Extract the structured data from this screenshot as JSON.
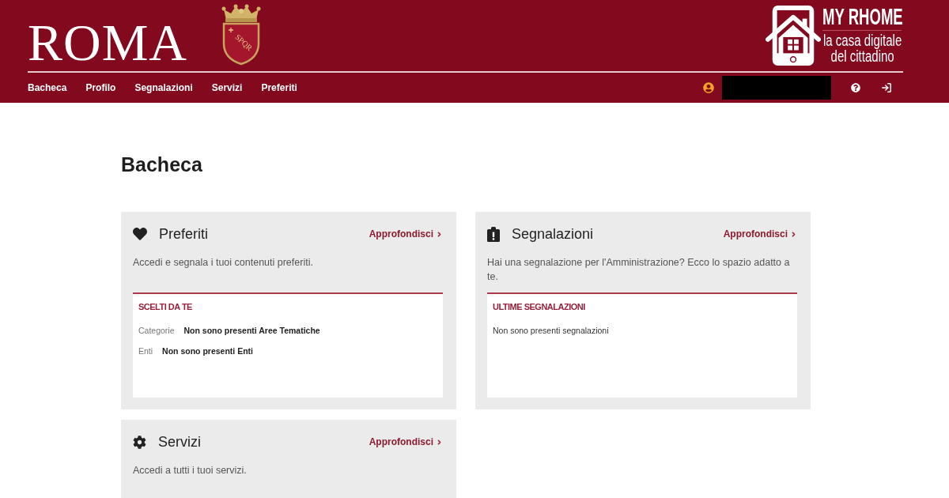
{
  "header": {
    "city_name": "ROMA",
    "crest_motto": "SPQR",
    "app_name": "MY RHOME",
    "app_tagline": "la casa digitale del cittadino",
    "nav": [
      "Bacheca",
      "Profilo",
      "Segnalazioni",
      "Servizi",
      "Preferiti"
    ]
  },
  "page_title": "Bacheca",
  "cards": [
    {
      "kind": "favorites",
      "title": "Preferiti",
      "link": "Approfondisci",
      "description": "Accedi e segnala i tuoi contenuti preferiti.",
      "panel": {
        "heading": "SCELTI DA TE",
        "rows": [
          {
            "label": "Categorie",
            "value": "Non sono presenti Aree Tematiche"
          },
          {
            "label": "Enti",
            "value": "Non sono presenti Enti"
          }
        ]
      }
    },
    {
      "kind": "reports",
      "title": "Segnalazioni",
      "link": "Approfondisci",
      "description": "Hai una segnalazione per l'Amministrazione? Ecco lo spazio adatto a te.",
      "panel": {
        "heading": "ULTIME SEGNALAZIONI",
        "message": "Non sono presenti segnalazioni"
      }
    },
    {
      "kind": "services",
      "title": "Servizi",
      "link": "Approfondisci",
      "description": "Accedi a tutti i tuoi servizi."
    }
  ]
}
